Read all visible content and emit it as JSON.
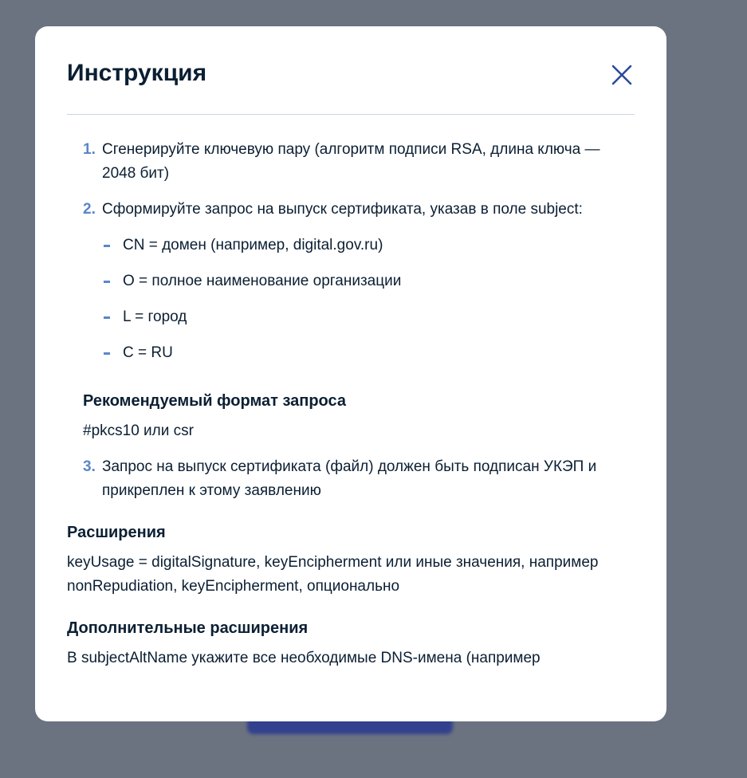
{
  "modal": {
    "title": "Инструкция",
    "close_icon": "close-icon"
  },
  "steps": [
    {
      "num": "1.",
      "text": "Сгенерируйте ключевую пару (алгоритм подписи RSA, длина ключа — 2048 бит)"
    },
    {
      "num": "2.",
      "text": "Сформируйте запрос на выпуск сертификата, указав в поле subject:",
      "subitems": [
        "CN = домен (например, digital.gov.ru)",
        "O = полное наименование организации",
        "L = город",
        "C = RU"
      ]
    },
    {
      "num": "3.",
      "text": "Запрос на выпуск сертификата (файл) должен быть подписан УКЭП и прикреплен к этому заявлению"
    }
  ],
  "request_format": {
    "heading": "Рекомендуемый формат запроса",
    "text": "#pkcs10 или csr"
  },
  "extensions": {
    "heading": "Расширения",
    "text": "keyUsage = digitalSignature, keyEncipherment или иные значения, например nonRepudiation, keyEncipherment, опционально"
  },
  "additional_extensions": {
    "heading": "Дополнительные расширения",
    "text": "В subjectAltName укажите все необходимые DNS-имена (например"
  },
  "colors": {
    "overlay": "#6b7280",
    "accent": "#5b86c9",
    "text": "#0b1f33",
    "button_behind": "#2b3c8f"
  }
}
